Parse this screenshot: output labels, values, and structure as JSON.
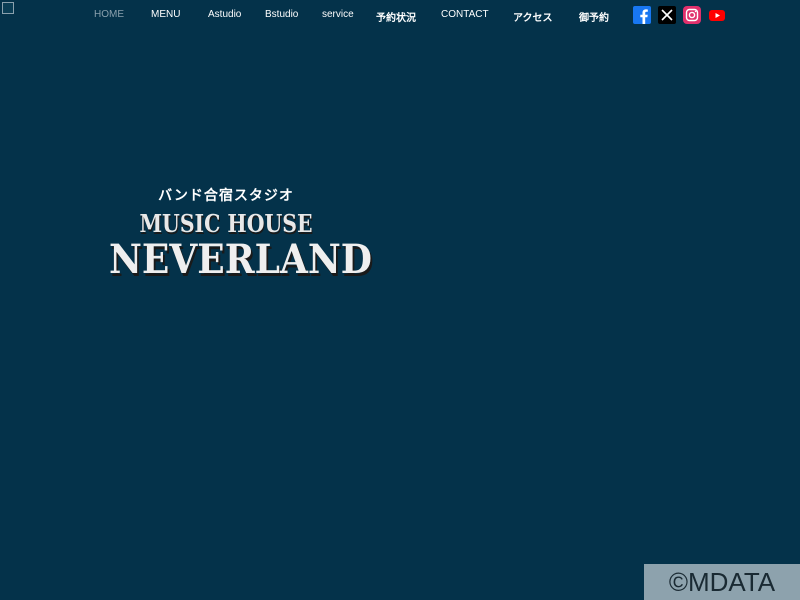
{
  "nav": {
    "items": [
      {
        "label": "HOME",
        "active": true
      },
      {
        "label": "MENU"
      },
      {
        "label": "Astudio"
      },
      {
        "label": "Bstudio"
      },
      {
        "label": "service"
      },
      {
        "label": "予約状況"
      },
      {
        "label": "CONTACT"
      },
      {
        "label": "アクセス"
      },
      {
        "label": "御予約"
      }
    ],
    "social": [
      {
        "name": "facebook-icon",
        "color": "#1877f2"
      },
      {
        "name": "x-icon",
        "color": "#000000"
      },
      {
        "name": "instagram-icon",
        "color": "#e1306c"
      },
      {
        "name": "youtube-icon",
        "color": "#ff0000"
      }
    ]
  },
  "hero": {
    "subtitle": "バンド合宿スタジオ",
    "line1": "MUSIC HOUSE",
    "line2": "NEVERLAND"
  },
  "watermark": "©MDATA",
  "colors": {
    "background": "#04324a",
    "nav_active": "#8aa0ad"
  }
}
